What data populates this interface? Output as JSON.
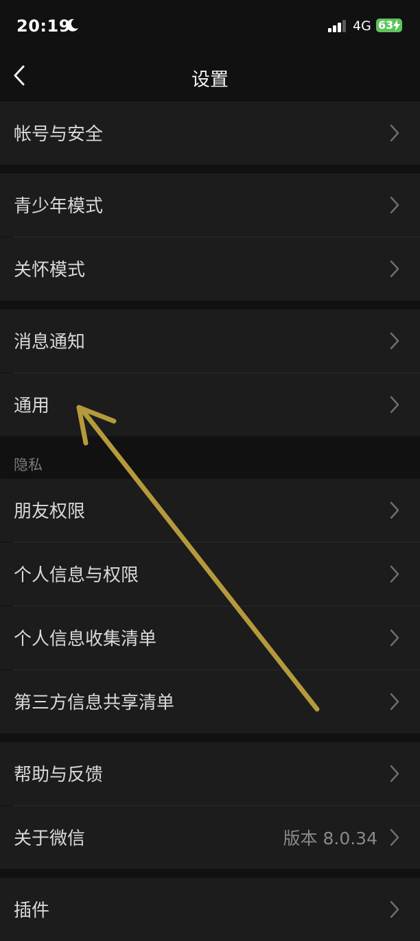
{
  "status_bar": {
    "time": "20:19",
    "network": "4G",
    "battery": "63",
    "moon_icon": "moon-icon",
    "signal_icon": "signal-bars-icon",
    "charging_icon": "bolt-icon"
  },
  "nav": {
    "title": "设置",
    "back_icon": "chevron-left-icon"
  },
  "groups": {
    "account": {
      "item": "帐号与安全"
    },
    "modes": {
      "teen": "青少年模式",
      "care": "关怀模式"
    },
    "notify": {
      "notifications": "消息通知",
      "general": "通用"
    },
    "privacy": {
      "caption": "隐私",
      "friends": "朋友权限",
      "personal_info": "个人信息与权限",
      "collection": "个人信息收集清单",
      "third_party": "第三方信息共享清单"
    },
    "help": {
      "feedback": "帮助与反馈",
      "about": "关于微信",
      "about_version": "版本 8.0.34"
    },
    "plugins": {
      "item": "插件"
    }
  },
  "colors": {
    "background": "#111111",
    "row": "#1c1c1c",
    "annotation_arrow": "#b59a3c",
    "battery": "#5bc55b"
  }
}
